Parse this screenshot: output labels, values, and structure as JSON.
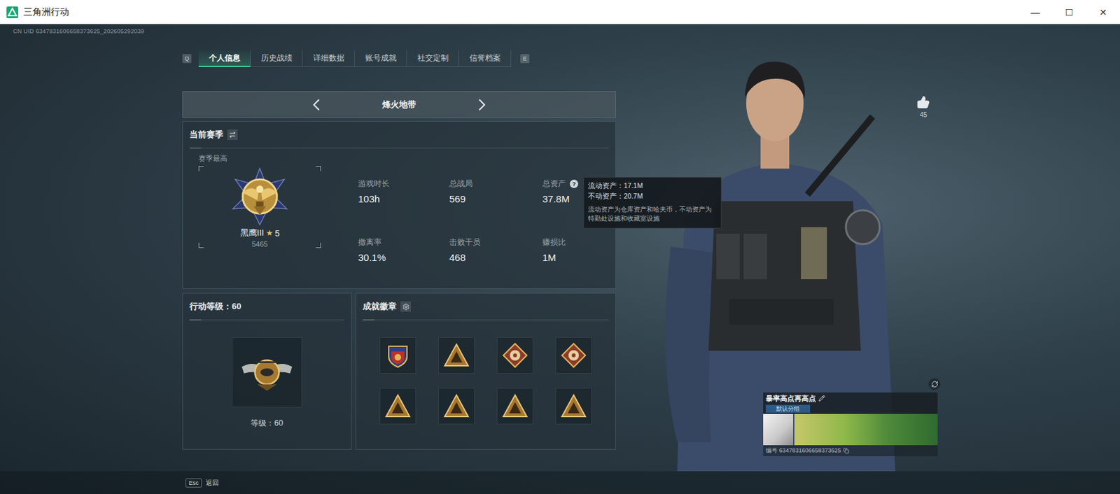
{
  "window": {
    "title": "三角洲行动",
    "controls": [
      "—",
      "☐",
      "✕"
    ]
  },
  "uid": "CN UID 6347831606658373625_202605292039",
  "tabs": {
    "prev_key": "Q",
    "next_key": "E",
    "items": [
      {
        "label": "个人信息",
        "selected": true
      },
      {
        "label": "历史战绩",
        "selected": false
      },
      {
        "label": "详细数据",
        "selected": false
      },
      {
        "label": "账号成就",
        "selected": false
      },
      {
        "label": "社交定制",
        "selected": false
      },
      {
        "label": "信誉档案",
        "selected": false
      }
    ]
  },
  "mode": {
    "label": "烽火地带"
  },
  "season": {
    "title": "当前赛季",
    "best_label": "赛季最高",
    "rank": "黑鹰III",
    "star": "★",
    "star_count": "5",
    "score": "5465",
    "stats": [
      {
        "label": "游戏时长",
        "value": "103h",
        "help": ""
      },
      {
        "label": "总战局",
        "value": "569",
        "help": ""
      },
      {
        "label": "总资产",
        "value": "37.8M",
        "help": "?"
      },
      {
        "label": "撤离率",
        "value": "30.1%",
        "help": ""
      },
      {
        "label": "击败干员",
        "value": "468",
        "help": ""
      },
      {
        "label": "赚损比",
        "value": "1M",
        "help": ""
      }
    ]
  },
  "tooltip": {
    "lines": [
      "流动资产：17.1M",
      "不动资产：20.7M"
    ],
    "note": "流动资产为仓库资产和哈夫币，不动资产为特勤处设施和收藏室设施"
  },
  "level": {
    "title": "行动等级：60",
    "caption": "等级：60"
  },
  "achievements": {
    "title": "成就徽章",
    "badges": [
      {
        "kind": "shield"
      },
      {
        "kind": "triangle"
      },
      {
        "kind": "diamond"
      },
      {
        "kind": "diamond"
      },
      {
        "kind": "triangle"
      },
      {
        "kind": "triangle"
      },
      {
        "kind": "triangle"
      },
      {
        "kind": "triangle"
      }
    ]
  },
  "profile": {
    "likes": "45",
    "name": "暴率高点再高点",
    "group": "默认分组",
    "id": "编号 6347831606658373625"
  },
  "footer": {
    "key": "Esc",
    "label": "返回"
  }
}
